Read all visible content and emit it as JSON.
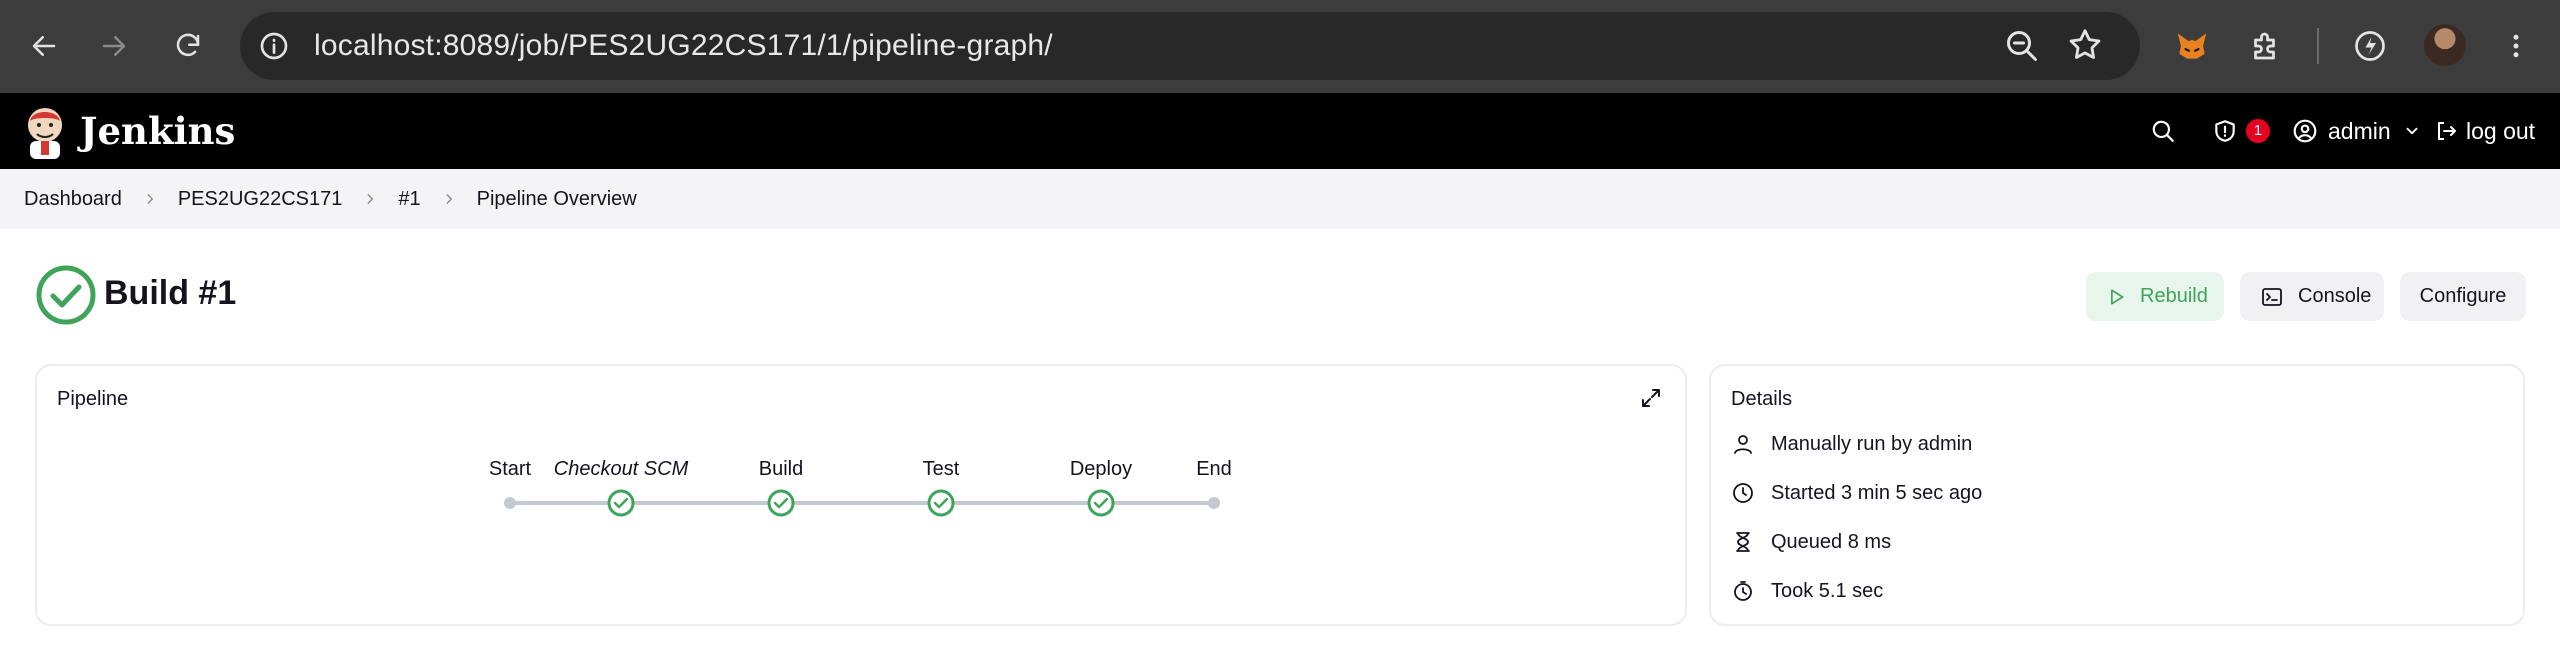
{
  "browser": {
    "url": "localhost:8089/job/PES2UG22CS171/1/pipeline-graph/"
  },
  "header": {
    "brand": "Jenkins",
    "security_count": "1",
    "user": "admin",
    "logout": "log out"
  },
  "breadcrumb": [
    "Dashboard",
    "PES2UG22CS171",
    "#1",
    "Pipeline Overview"
  ],
  "build": {
    "title": "Build #1",
    "status": "success",
    "rebuild_label": "Rebuild",
    "console_label": "Console",
    "configure_label": "Configure"
  },
  "pipeline": {
    "title": "Pipeline",
    "stages": [
      {
        "name": "Start",
        "kind": "start"
      },
      {
        "name": "Checkout SCM",
        "kind": "success",
        "italic": true
      },
      {
        "name": "Build",
        "kind": "success"
      },
      {
        "name": "Test",
        "kind": "success"
      },
      {
        "name": "Deploy",
        "kind": "success"
      },
      {
        "name": "End",
        "kind": "end"
      }
    ]
  },
  "details": {
    "title": "Details",
    "items": [
      {
        "icon": "user-icon",
        "text": "Manually run by admin"
      },
      {
        "icon": "clock-icon",
        "text": "Started 3 min 5 sec ago"
      },
      {
        "icon": "hourglass-icon",
        "text": "Queued 8 ms"
      },
      {
        "icon": "timer-icon",
        "text": "Took 5.1 sec"
      }
    ]
  },
  "colors": {
    "success": "#3fa35a",
    "connector": "#c4c8d0",
    "header_bg": "#000000",
    "crumb_bg": "#f4f4f6"
  }
}
